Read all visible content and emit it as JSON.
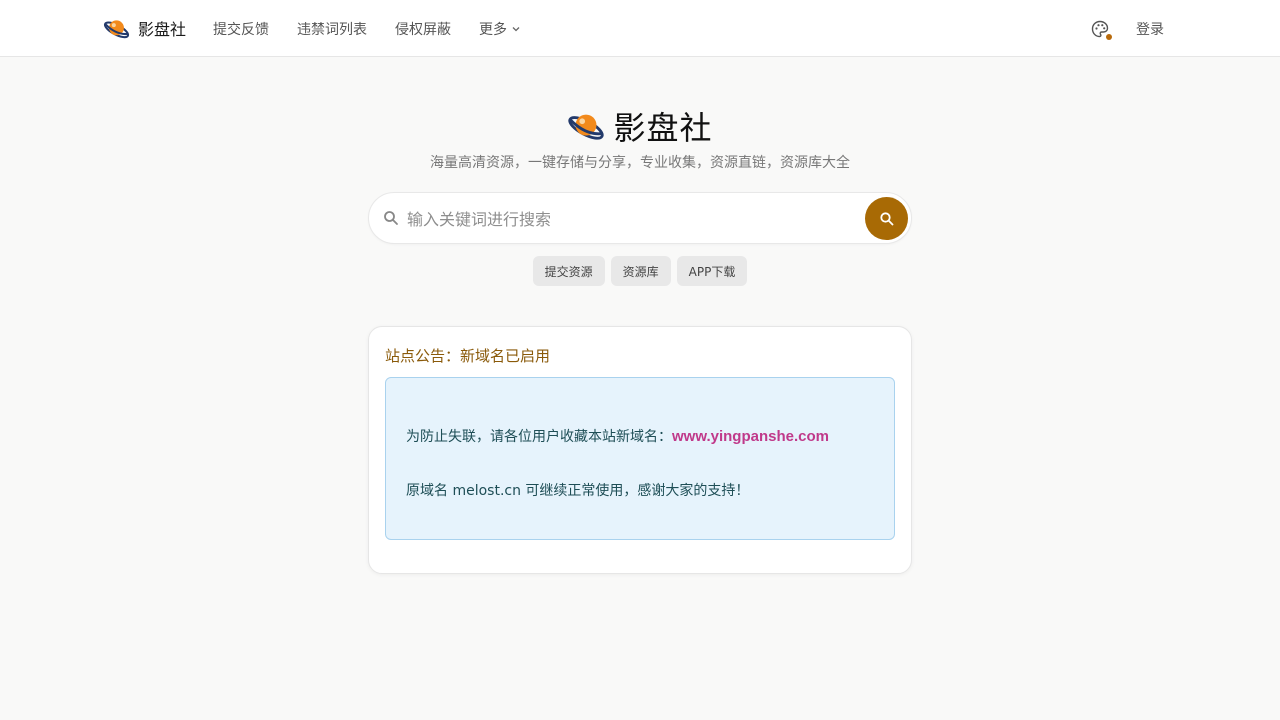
{
  "header": {
    "brand": "影盘社",
    "nav": [
      "提交反馈",
      "违禁词列表",
      "侵权屏蔽",
      "更多"
    ],
    "login": "登录"
  },
  "hero": {
    "title": "影盘社",
    "subtitle": "海量高清资源，一键存储与分享，专业收集，资源直链，资源库大全"
  },
  "search": {
    "placeholder": "输入关键词进行搜索"
  },
  "quick_links": [
    "提交资源",
    "资源库",
    "APP下载"
  ],
  "announcement": {
    "title": "站点公告：新域名已启用",
    "line1_prefix": "为防止失联，请各位用户收藏本站新域名：",
    "line1_domain": "www.yingpanshe.com",
    "line2": "原域名 melost.cn 可继续正常使用，感谢大家的支持！"
  },
  "colors": {
    "accent": "#a86a05",
    "title_accent": "#8a5a0a",
    "domain_highlight": "#c0398a",
    "notice_bg": "#e6f3fc"
  },
  "icons": [
    "planet-logo-icon",
    "chevron-down-icon",
    "palette-icon",
    "search-icon"
  ]
}
